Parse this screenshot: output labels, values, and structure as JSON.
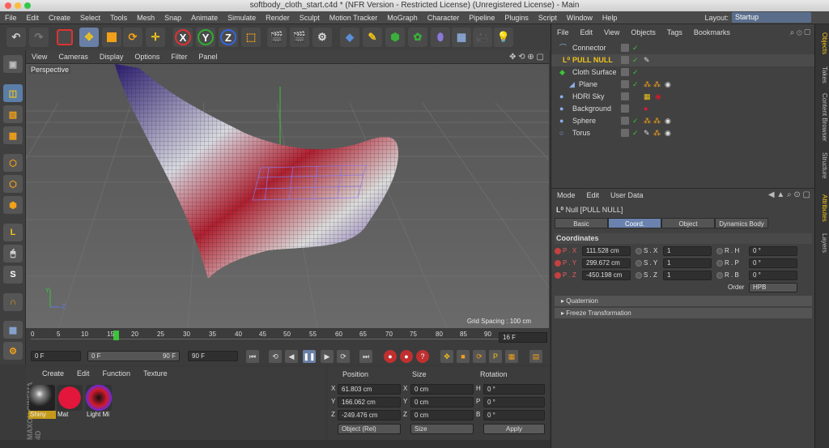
{
  "window": {
    "title": "softbody_cloth_start.c4d * (NFR Version - Restricted License) (Unregistered License) - Main"
  },
  "menubar": {
    "items": [
      "File",
      "Edit",
      "Create",
      "Select",
      "Tools",
      "Mesh",
      "Snap",
      "Animate",
      "Simulate",
      "Render",
      "Sculpt",
      "Motion Tracker",
      "MoGraph",
      "Character",
      "Pipeline",
      "Plugins",
      "Script",
      "Window",
      "Help"
    ],
    "layout_label": "Layout:",
    "layout_value": "Startup"
  },
  "toolbar": {
    "x_label": "X",
    "y_label": "Y",
    "z_label": "Z"
  },
  "viewport": {
    "menu": [
      "View",
      "Cameras",
      "Display",
      "Options",
      "Filter",
      "Panel"
    ],
    "view_name": "Perspective",
    "grid_spacing": "Grid Spacing : 100 cm"
  },
  "timeline": {
    "ticks": [
      "0",
      "5",
      "10",
      "15",
      "20",
      "25",
      "30",
      "35",
      "40",
      "45",
      "50",
      "55",
      "60",
      "65",
      "70",
      "75",
      "80",
      "85",
      "90"
    ],
    "current_frame": "16 F",
    "start": "0 F",
    "range_start": "0 F",
    "range_end": "90 F",
    "end": "90 F"
  },
  "materials": {
    "menu": [
      "Create",
      "Edit",
      "Function",
      "Texture"
    ],
    "items": [
      {
        "name": "Shiny",
        "color": "#222222"
      },
      {
        "name": "Mat",
        "color": "#e3163c"
      },
      {
        "name": "Light Mi",
        "color": "#d11a2a"
      }
    ],
    "brand": "MAXON CINEMA 4D"
  },
  "coordinates": {
    "headers": {
      "position": "Position",
      "size": "Size",
      "rotation": "Rotation"
    },
    "rows": [
      {
        "axis": "X",
        "pos": "61.803 cm",
        "size_axis": "X",
        "size": "0 cm",
        "rot_axis": "H",
        "rot": "0 °"
      },
      {
        "axis": "Y",
        "pos": "166.062 cm",
        "size_axis": "Y",
        "size": "0 cm",
        "rot_axis": "P",
        "rot": "0 °"
      },
      {
        "axis": "Z",
        "pos": "-249.476 cm",
        "size_axis": "Z",
        "size": "0 cm",
        "rot_axis": "B",
        "rot": "0 °"
      }
    ],
    "mode": "Object (Rel)",
    "size_mode": "Size",
    "apply": "Apply"
  },
  "objects": {
    "menu": [
      "File",
      "Edit",
      "View",
      "Objects",
      "Tags",
      "Bookmarks"
    ],
    "items": [
      {
        "name": "Connector",
        "indent": 0,
        "color": "#dcdcdc"
      },
      {
        "name": "PULL NULL",
        "indent": 1,
        "color": "#f0c419"
      },
      {
        "name": "Cloth Surface",
        "indent": 0,
        "color": "#dcdcdc"
      },
      {
        "name": "Plane",
        "indent": 1,
        "color": "#dcdcdc"
      },
      {
        "name": "HDRI Sky",
        "indent": 0,
        "color": "#dcdcdc"
      },
      {
        "name": "Background",
        "indent": 0,
        "color": "#dcdcdc"
      },
      {
        "name": "Sphere",
        "indent": 0,
        "color": "#dcdcdc"
      },
      {
        "name": "Torus",
        "indent": 0,
        "color": "#dcdcdc"
      }
    ]
  },
  "attributes": {
    "menu": [
      "Mode",
      "Edit",
      "User Data"
    ],
    "object_title": "Null [PULL NULL]",
    "tabs": [
      "Basic",
      "Coord.",
      "Object",
      "Dynamics Body"
    ],
    "active_tab": "Coord.",
    "section": "Coordinates",
    "rows": [
      {
        "p_label": "P . X",
        "p": "111.528 cm",
        "s_label": "S . X",
        "s": "1",
        "r_label": "R . H",
        "r": "0 °"
      },
      {
        "p_label": "P . Y",
        "p": "299.672 cm",
        "s_label": "S . Y",
        "s": "1",
        "r_label": "R . P",
        "r": "0 °"
      },
      {
        "p_label": "P . Z",
        "p": "-450.198 cm",
        "s_label": "S . Z",
        "s": "1",
        "r_label": "R . B",
        "r": "0 °"
      }
    ],
    "order_label": "Order",
    "order_value": "HPB",
    "collapsed": [
      "Quaternion",
      "Freeze Transformation"
    ]
  },
  "side_tabs": [
    "Objects",
    "Takes",
    "Content Browser",
    "Structure",
    "Attributes",
    "Layers"
  ]
}
